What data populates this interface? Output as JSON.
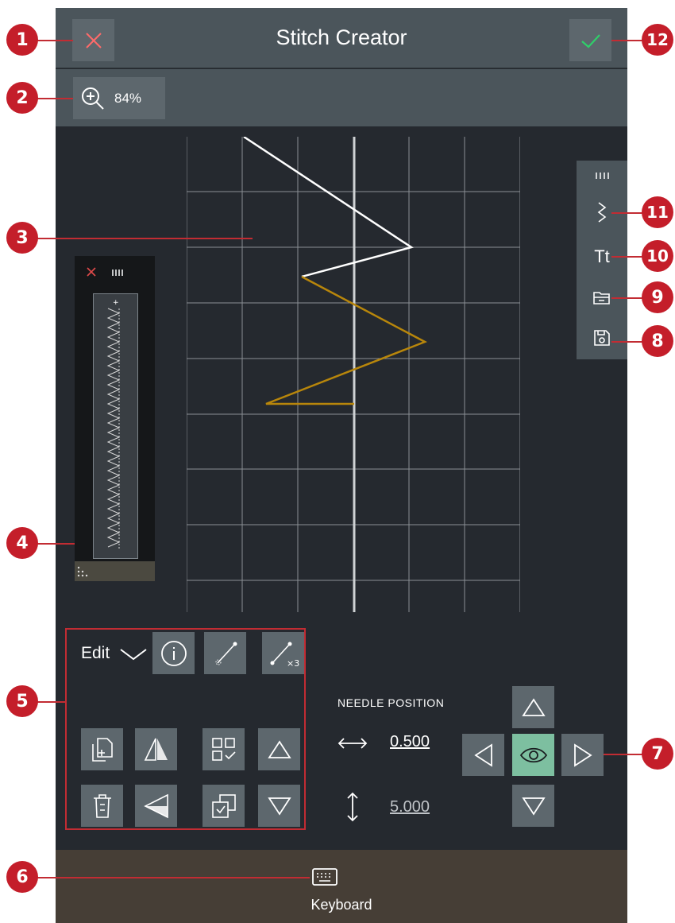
{
  "header": {
    "title": "Stitch Creator",
    "cancel_icon": "close-icon",
    "confirm_icon": "check-icon"
  },
  "zoom": {
    "value": "84%",
    "icon": "zoom-in-icon"
  },
  "overview": {
    "close_icon": "close-icon",
    "bars_icon": "bars-icon",
    "footer_icon": "grip-dots-icon"
  },
  "side_tools": [
    {
      "name": "bars",
      "icon": "bars-icon"
    },
    {
      "name": "stitch-type",
      "icon": "zigzag-icon"
    },
    {
      "name": "text",
      "label": "Tt",
      "icon": "text-icon"
    },
    {
      "name": "open",
      "icon": "folder-icon"
    },
    {
      "name": "save",
      "icon": "save-icon"
    }
  ],
  "edit": {
    "label": "Edit",
    "icons_row1": [
      "info-icon",
      "single-stitch-icon",
      "triple-stitch-icon"
    ],
    "icons_row2": [
      "duplicate-icon",
      "mirror-side-icon",
      "select-all-icon",
      "up-arrow-icon"
    ],
    "icons_row3": [
      "delete-icon",
      "mirror-end-icon",
      "multi-select-icon",
      "down-arrow-icon"
    ]
  },
  "needle": {
    "label": "NEEDLE POSITION",
    "horizontal_value": "0.500",
    "vertical_value": "5.000"
  },
  "bottom": {
    "keyboard_label": "Keyboard",
    "keyboard_icon": "keyboard-icon"
  },
  "callouts": [
    "1",
    "2",
    "3",
    "4",
    "5",
    "6",
    "7",
    "8",
    "9",
    "10",
    "11",
    "12"
  ],
  "colors": {
    "accent_red": "#c41e2a",
    "stitch_white": "#ffffff",
    "stitch_gold": "#b8860b",
    "selected_green": "#7dbfa0"
  }
}
